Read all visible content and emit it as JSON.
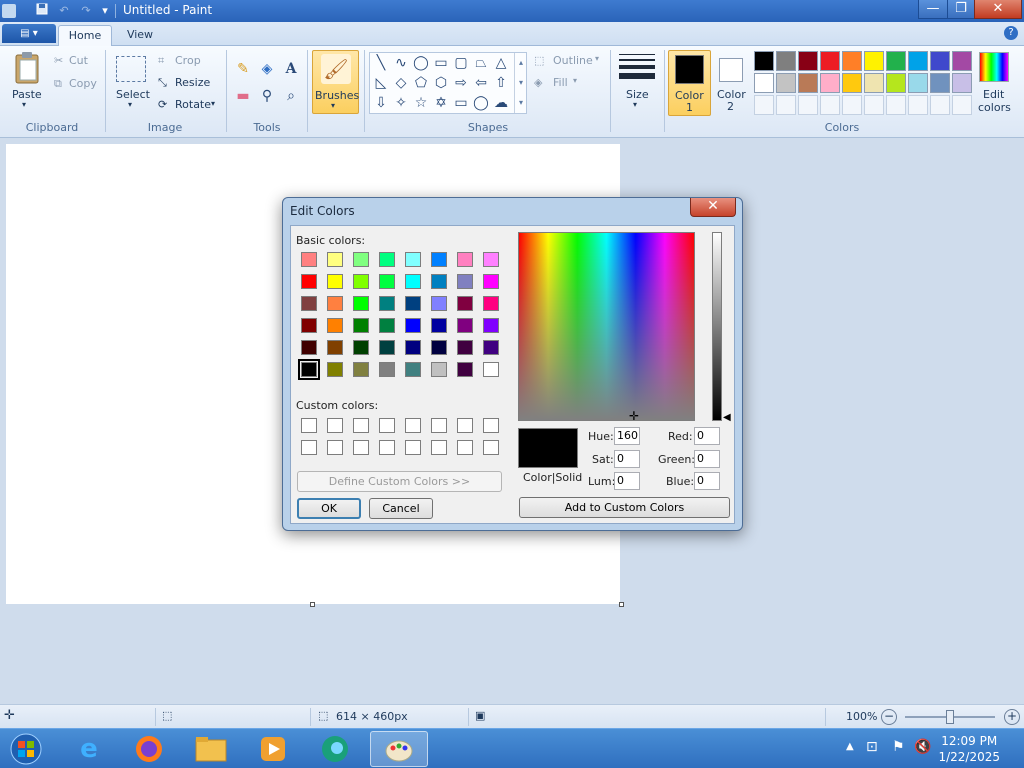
{
  "window": {
    "title": "Untitled - Paint",
    "minimize": "—",
    "maximize": "❐",
    "close": "✕"
  },
  "tabs": {
    "app_menu": "▤ ▾",
    "home": "Home",
    "view": "View",
    "help": "?"
  },
  "ribbon": {
    "clipboard": {
      "paste": "Paste",
      "cut": "Cut",
      "copy": "Copy",
      "label": "Clipboard"
    },
    "image": {
      "select": "Select",
      "crop": "Crop",
      "resize": "Resize",
      "rotate": "Rotate",
      "label": "Image"
    },
    "tools": {
      "label": "Tools"
    },
    "brushes": {
      "label": "Brushes"
    },
    "shapes": {
      "outline": "Outline",
      "fill": "Fill",
      "label": "Shapes"
    },
    "size": {
      "label": "Size"
    },
    "colors": {
      "color1": "Color",
      "color1_num": "1",
      "color2": "Color",
      "color2_num": "2",
      "edit": "Edit",
      "edit2": "colors",
      "label": "Colors",
      "palette": [
        "#000000",
        "#7f7f7f",
        "#880015",
        "#ed1c24",
        "#ff7f27",
        "#fff200",
        "#22b14c",
        "#00a2e8",
        "#3f48cc",
        "#a349a4",
        "#ffffff",
        "#c3c3c3",
        "#b97a57",
        "#ffaec9",
        "#ffc90e",
        "#efe4b0",
        "#b5e61d",
        "#99d9ea",
        "#7092be",
        "#c8bfe7"
      ],
      "color1_value": "#000000",
      "color2_value": "#ffffff"
    }
  },
  "dialog": {
    "title": "Edit Colors",
    "close": "✕",
    "basic_label": "Basic colors:",
    "custom_label": "Custom colors:",
    "define_button": "Define Custom Colors >>",
    "ok_button": "OK",
    "cancel_button": "Cancel",
    "add_button": "Add to Custom Colors",
    "color_solid": "Color|Solid",
    "hue_label": "Hue:",
    "hue": "160",
    "sat_label": "Sat:",
    "sat": "0",
    "lum_label": "Lum:",
    "lum": "0",
    "red_label": "Red:",
    "red": "0",
    "green_label": "Green:",
    "green": "0",
    "blue_label": "Blue:",
    "blue": "0",
    "basic_colors": [
      "#ff8080",
      "#ffff80",
      "#80ff80",
      "#00ff80",
      "#80ffff",
      "#0080ff",
      "#ff80c0",
      "#ff80ff",
      "#ff0000",
      "#ffff00",
      "#80ff00",
      "#00ff40",
      "#00ffff",
      "#0080c0",
      "#8080c0",
      "#ff00ff",
      "#804040",
      "#ff8040",
      "#00ff00",
      "#008080",
      "#004080",
      "#8080ff",
      "#800040",
      "#ff0080",
      "#800000",
      "#ff8000",
      "#008000",
      "#008040",
      "#0000ff",
      "#0000a0",
      "#800080",
      "#8000ff",
      "#400000",
      "#804000",
      "#004000",
      "#004040",
      "#000080",
      "#000040",
      "#400040",
      "#400080",
      "#000000",
      "#808000",
      "#808040",
      "#808080",
      "#408080",
      "#c0c0c0",
      "#400040",
      "#ffffff"
    ],
    "selected_index": 40,
    "current_color": "#000000"
  },
  "status": {
    "dimensions": "614 × 460px",
    "zoom": "100%"
  },
  "taskbar": {
    "time": "12:09 PM",
    "date": "1/22/2025"
  }
}
